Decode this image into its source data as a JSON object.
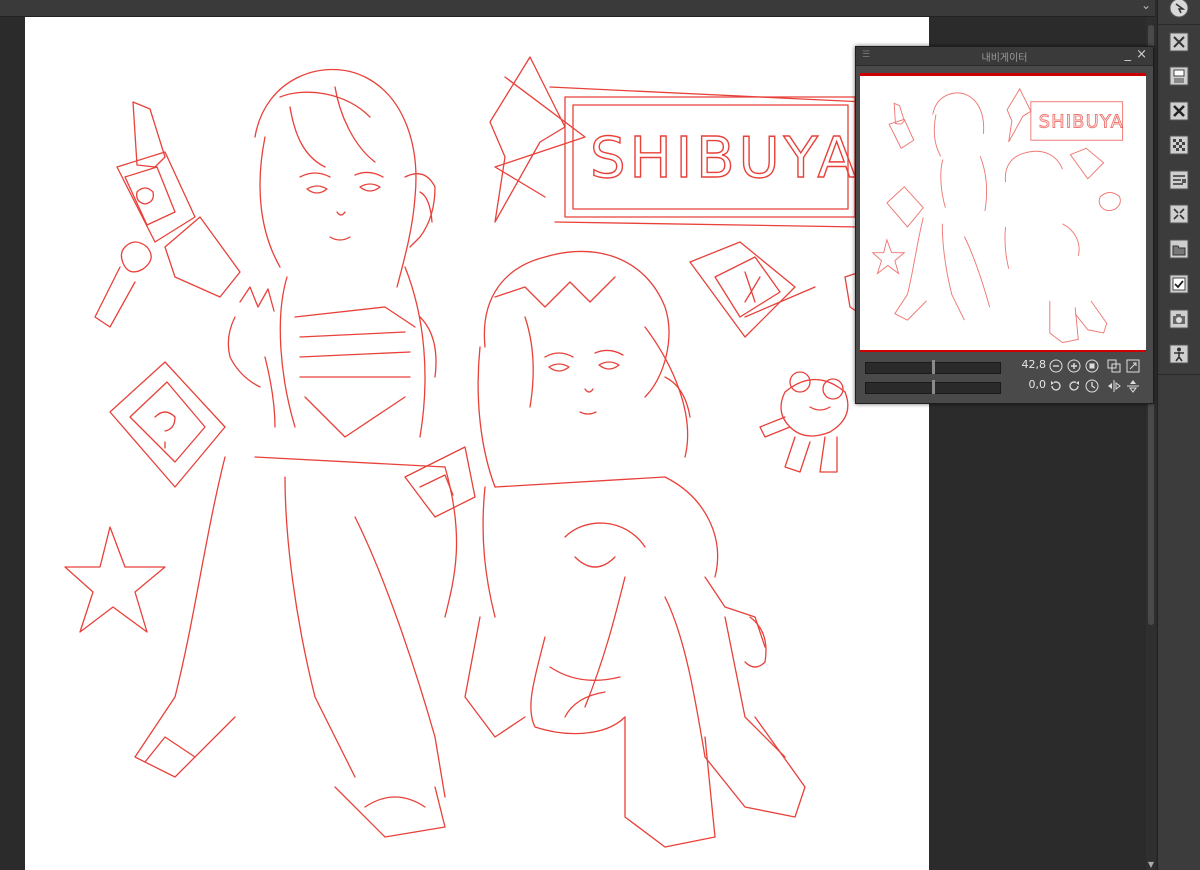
{
  "app": {
    "topbar_chevron": "⌄"
  },
  "navigator": {
    "title": "내비게이터",
    "minimize_label": "_",
    "close_label": "×",
    "zoom_value": "42,8",
    "zoom_level": 0.5,
    "rotate_value": "0,0",
    "rotate_level": 0.5
  },
  "canvas": {
    "text_in_artwork": "SHIBUYA"
  },
  "toolbar": {
    "tools": [
      {
        "icon": "pointer-target-icon"
      },
      {
        "icon": "close-layer-icon"
      },
      {
        "icon": "save-document-icon"
      },
      {
        "icon": "clear-icon"
      },
      {
        "icon": "grid-pattern-icon"
      },
      {
        "icon": "document-properties-icon"
      },
      {
        "icon": "transform-icon"
      },
      {
        "icon": "folder-icon"
      },
      {
        "icon": "checklist-icon"
      },
      {
        "icon": "camera-icon"
      },
      {
        "icon": "person-figure-icon"
      }
    ]
  },
  "colors": {
    "sketch_red": "#e8413a",
    "ui_dark": "#2b2b2b",
    "panel": "#4a4a4a",
    "nav_accent": "#cc0000"
  }
}
